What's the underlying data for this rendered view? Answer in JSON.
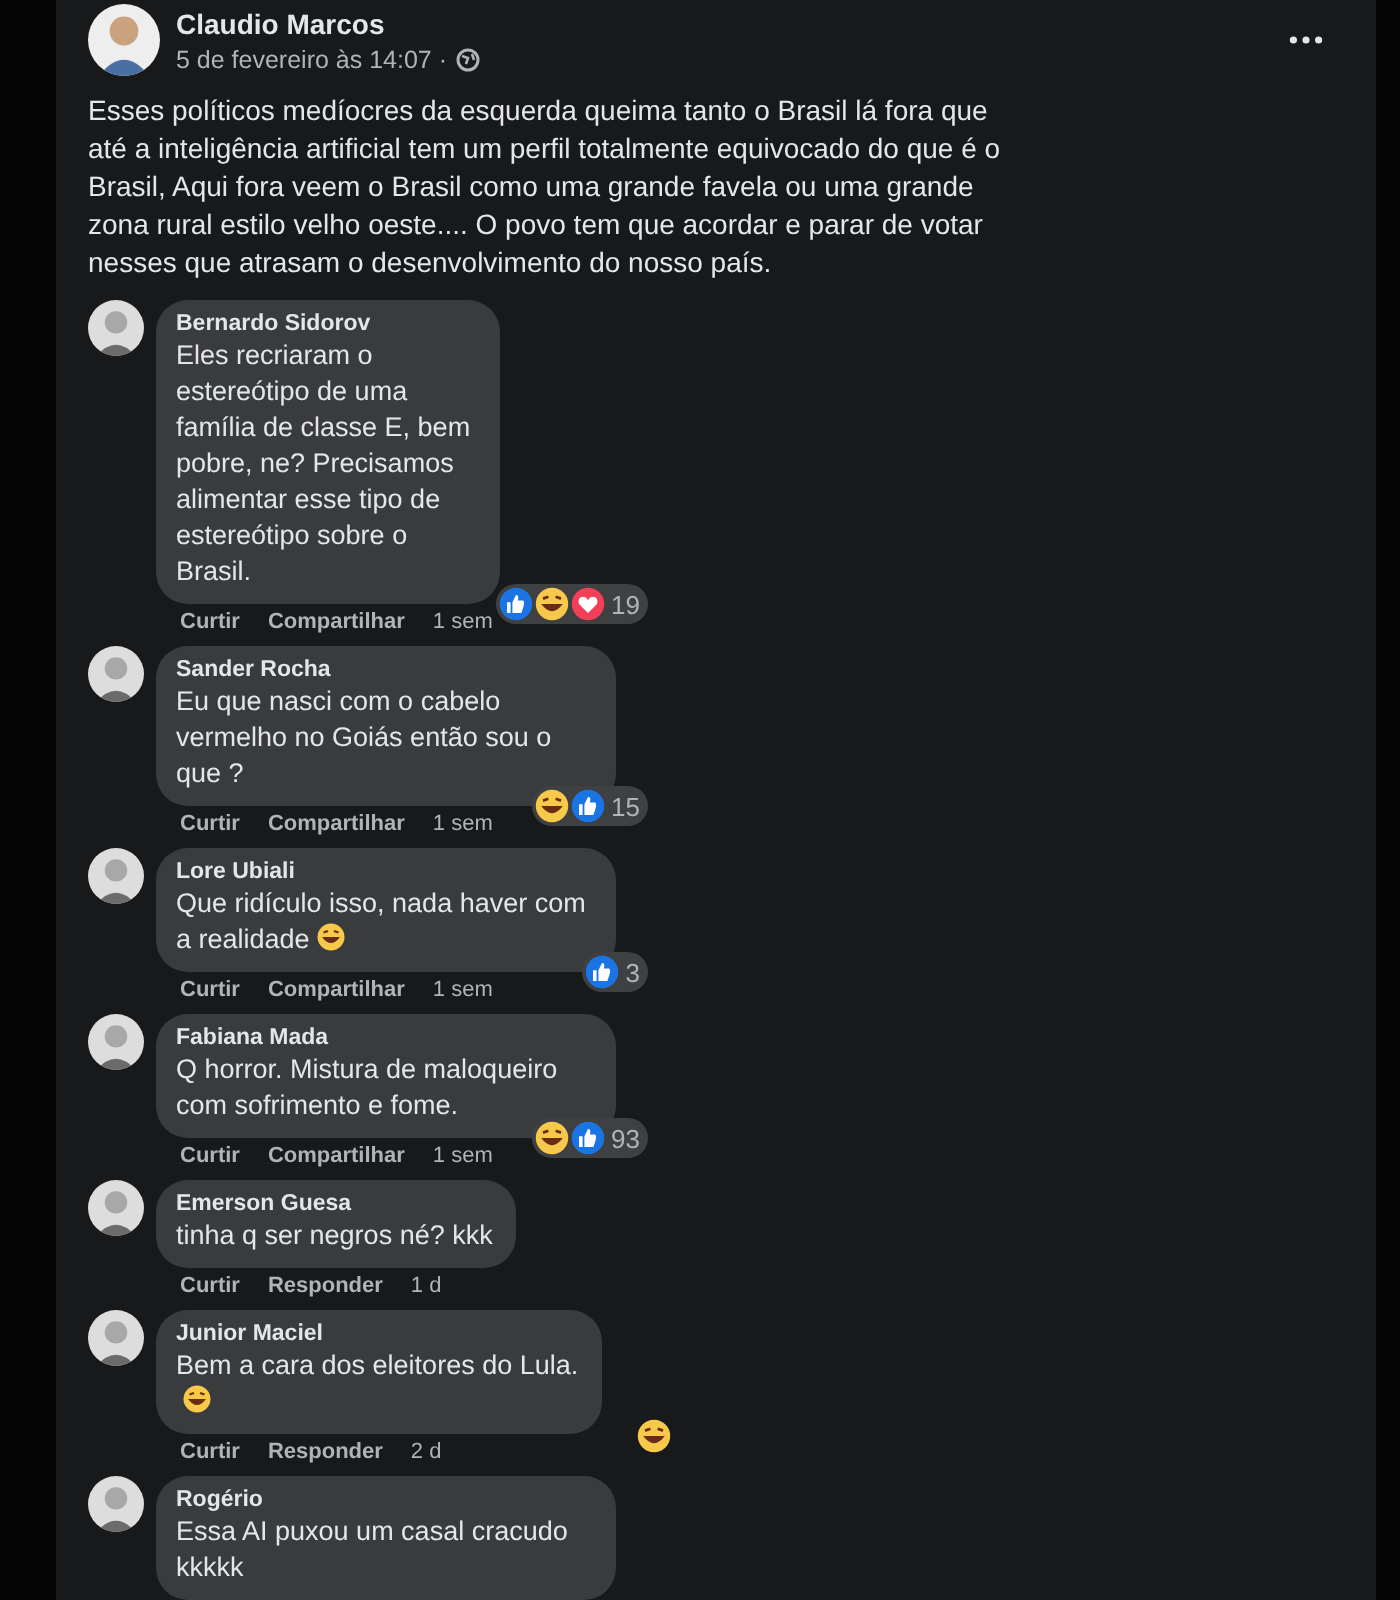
{
  "post": {
    "author": "Claudio Marcos",
    "date": "5 de fevereiro às 14:07 ·",
    "text": "Esses políticos medíocres da esquerda queima tanto o Brasil lá fora que até a inteligência artificial tem um perfil totalmente equivocado do que é o Brasil, Aqui fora veem o Brasil como uma grande favela ou uma grande zona rural estilo velho oeste.... O povo tem que acordar e parar de votar nesses que atrasam o desenvolvimento do nosso país."
  },
  "comments": [
    {
      "name": "Bernardo Sidorov",
      "text": "Eles recriaram o estereótipo de uma família de classe E, bem pobre, ne? Precisamos alimentar esse tipo de estereótipo sobre o Brasil.",
      "reactions": [
        {
          "kind": "like"
        },
        {
          "kind": "haha"
        },
        {
          "kind": "love"
        }
      ],
      "reaction_count": "19",
      "actions": [
        "Curtir",
        "Compartilhar"
      ],
      "time": "1 sem"
    },
    {
      "name": "Sander Rocha",
      "text": "Eu que nasci com o cabelo vermelho no Goiás então sou o que ?",
      "reactions": [
        {
          "kind": "haha"
        },
        {
          "kind": "like"
        }
      ],
      "reaction_count": "15",
      "actions": [
        "Curtir",
        "Compartilhar"
      ],
      "time": "1 sem"
    },
    {
      "name": "Lore Ubiali",
      "text": "Que ridículo isso, nada haver com a realidade",
      "laugh_emoji": true,
      "reactions": [
        {
          "kind": "like"
        }
      ],
      "reaction_count": "3",
      "actions": [
        "Curtir",
        "Compartilhar"
      ],
      "time": "1 sem"
    },
    {
      "name": "Fabiana Mada",
      "text": "Q horror. Mistura de maloqueiro com sofrimento e fome.",
      "reactions": [
        {
          "kind": "haha"
        },
        {
          "kind": "like"
        }
      ],
      "reaction_count": "93",
      "actions": [
        "Curtir",
        "Compartilhar"
      ],
      "time": "1 sem"
    },
    {
      "name": "Emerson Guesa",
      "text": "tinha q ser negros né? kkk",
      "actions": [
        "Curtir",
        "Responder"
      ],
      "time": "1 d"
    },
    {
      "name": "Junior Maciel",
      "text": "Bem a cara dos eleitores do Lula.",
      "laugh_emoji": true,
      "reactions": [
        {
          "kind": "haha"
        }
      ],
      "actions": [
        "Curtir",
        "Responder"
      ],
      "time": "2 d"
    },
    {
      "name": "Rogério",
      "text": "Essa AI puxou um casal cracudo kkkkk"
    }
  ]
}
